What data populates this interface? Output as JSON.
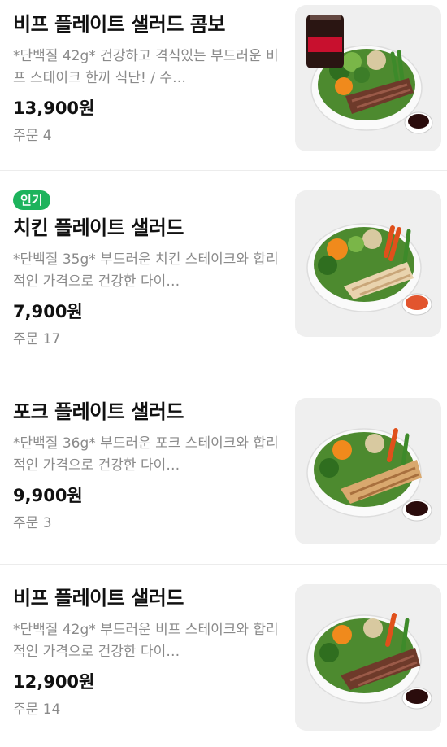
{
  "menu_items": [
    {
      "name": "비프 플레이트 샐러드 콤보",
      "description": "*단백질 42g* 건강하고 격식있는 부드러운 비프 스테이크 한끼 식단! / 수…",
      "price": "13,900원",
      "orders_label": "주문",
      "orders_count": "4",
      "badge": "",
      "image": "beef-salad-with-cola-image"
    },
    {
      "name": "치킨 플레이트 샐러드",
      "description": "*단백질 35g* 부드러운 치킨 스테이크와 합리적인 가격으로 건강한 다이…",
      "price": "7,900원",
      "orders_label": "주문",
      "orders_count": "17",
      "badge": "인기",
      "image": "chicken-salad-image"
    },
    {
      "name": "포크 플레이트 샐러드",
      "description": "*단백질 36g* 부드러운 포크 스테이크와 합리적인 가격으로 건강한 다이…",
      "price": "9,900원",
      "orders_label": "주문",
      "orders_count": "3",
      "badge": "",
      "image": "pork-salad-image"
    },
    {
      "name": "비프 플레이트 샐러드",
      "description": "*단백질 42g* 부드러운 비프 스테이크와 합리적인 가격으로 건강한 다이…",
      "price": "12,900원",
      "orders_label": "주문",
      "orders_count": "14",
      "badge": "",
      "image": "beef-salad-image"
    }
  ],
  "colors": {
    "badge": "#1db35c",
    "muted_text": "#8a8a8a",
    "thumb_bg": "#efefef"
  }
}
